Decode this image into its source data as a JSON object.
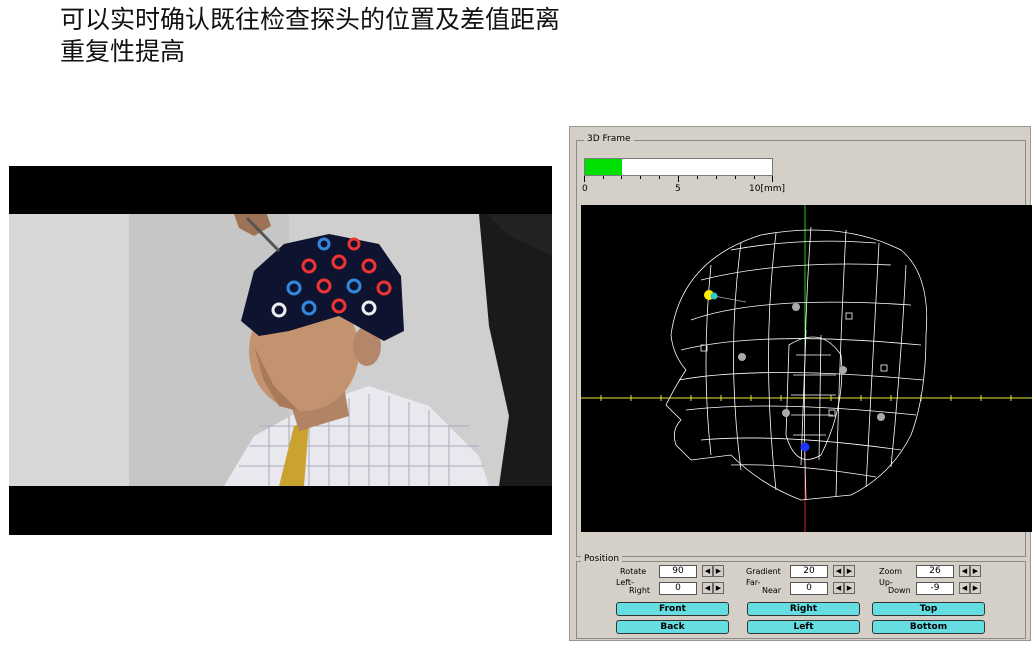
{
  "headline": {
    "line1": "可以实时确认既往检查探头的位置及差值距离",
    "line2": "重复性提高"
  },
  "software": {
    "frame_title": "3D Frame",
    "progress_value_mm": 2,
    "scale": {
      "min": "0",
      "mid": "5",
      "max": "10[mm]"
    },
    "fill_color": "#00e000",
    "position_title": "Position",
    "controls": [
      {
        "label": "Rotate",
        "value": "90"
      },
      {
        "label": "Gradient",
        "value": "20"
      },
      {
        "label": "Zoom",
        "value": "26"
      },
      {
        "label1": "Left-",
        "label2": "Right",
        "value": "0"
      },
      {
        "label1": "Far-",
        "label2": "Near",
        "value": "0"
      },
      {
        "label1": "Up-",
        "label2": "Down",
        "value": "-9"
      }
    ],
    "spin_left": "◀",
    "spin_right": "▶",
    "buttons": {
      "front": "Front",
      "right": "Right",
      "top": "Top",
      "back": "Back",
      "left": "Left",
      "bottom": "Bottom"
    },
    "button_color": "#66dde0"
  }
}
